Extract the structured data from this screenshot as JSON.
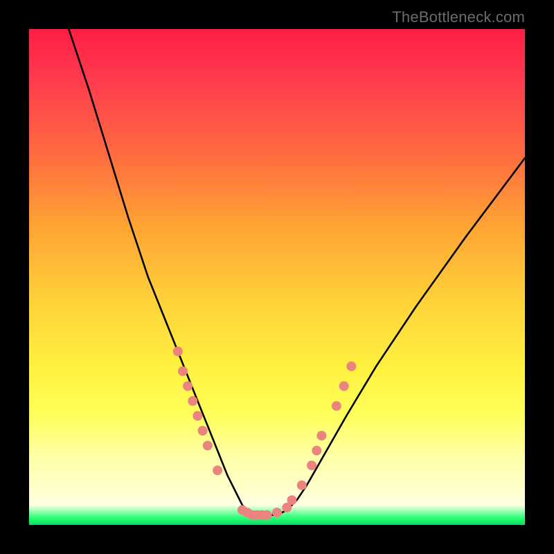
{
  "watermark": "TheBottleneck.com",
  "chart_data": {
    "type": "line",
    "title": "",
    "xlabel": "",
    "ylabel": "",
    "xlim": [
      0,
      100
    ],
    "ylim": [
      0,
      100
    ],
    "grid": false,
    "legend": false,
    "series": [
      {
        "name": "bottleneck-curve",
        "color": "#000000",
        "x": [
          8,
          12,
          16,
          20,
          24,
          28,
          30,
          32,
          34,
          36,
          38,
          40,
          42,
          43,
          44,
          45,
          46,
          48,
          50,
          52,
          54,
          56,
          60,
          64,
          70,
          78,
          88,
          100
        ],
        "values": [
          100,
          88,
          75,
          62,
          50,
          40,
          35,
          30,
          25,
          20,
          15,
          10,
          6,
          4,
          3,
          2,
          2,
          2,
          2,
          3,
          5,
          8,
          15,
          22,
          32,
          44,
          58,
          74
        ]
      }
    ],
    "markers": {
      "name": "highlight-dots",
      "color": "#e9847f",
      "radius": 7,
      "points": [
        {
          "x": 30,
          "y": 35
        },
        {
          "x": 31,
          "y": 31
        },
        {
          "x": 32,
          "y": 28
        },
        {
          "x": 33,
          "y": 25
        },
        {
          "x": 34,
          "y": 22
        },
        {
          "x": 35,
          "y": 19
        },
        {
          "x": 36,
          "y": 16
        },
        {
          "x": 38,
          "y": 11
        },
        {
          "x": 43,
          "y": 3
        },
        {
          "x": 44,
          "y": 2.5
        },
        {
          "x": 45,
          "y": 2
        },
        {
          "x": 46,
          "y": 2
        },
        {
          "x": 47,
          "y": 2
        },
        {
          "x": 48,
          "y": 2
        },
        {
          "x": 50,
          "y": 2.5
        },
        {
          "x": 52,
          "y": 3.5
        },
        {
          "x": 53,
          "y": 5
        },
        {
          "x": 55,
          "y": 8
        },
        {
          "x": 57,
          "y": 12
        },
        {
          "x": 58,
          "y": 15
        },
        {
          "x": 59,
          "y": 18
        },
        {
          "x": 62,
          "y": 24
        },
        {
          "x": 63.5,
          "y": 28
        },
        {
          "x": 65,
          "y": 32
        }
      ]
    },
    "background_gradient": {
      "orientation": "vertical",
      "stops": [
        {
          "pos": 0.0,
          "color": "#ff1e44"
        },
        {
          "pos": 0.55,
          "color": "#ffd23a"
        },
        {
          "pos": 0.92,
          "color": "#ffffc8"
        },
        {
          "pos": 1.0,
          "color": "#00e060"
        }
      ]
    }
  }
}
